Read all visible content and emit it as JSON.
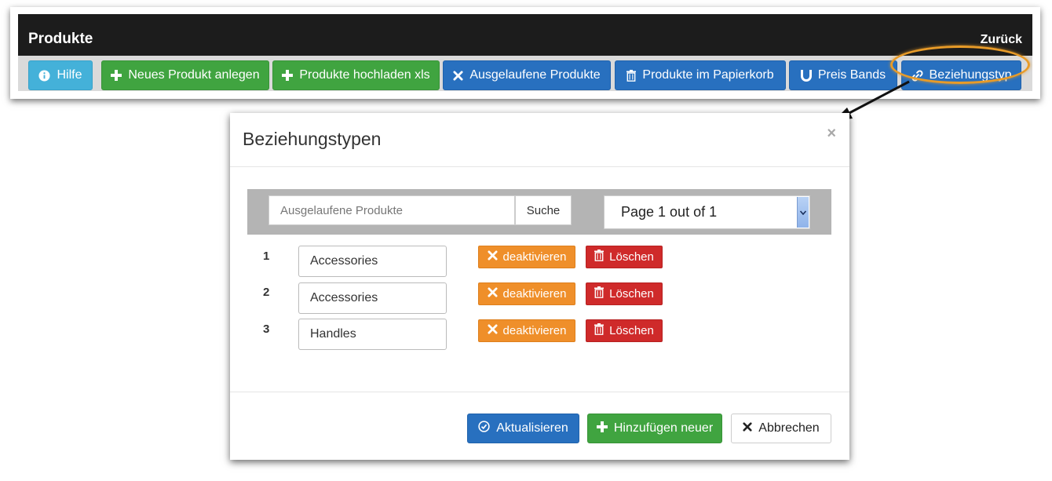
{
  "header": {
    "title": "Produkte",
    "back_label": "Zurück"
  },
  "toolbar": {
    "buttons": [
      {
        "label": "Hilfe",
        "icon": "info-icon",
        "color": "#44b1d9"
      },
      {
        "label": "Neues Produkt anlegen",
        "icon": "plus-icon",
        "color": "#40a440"
      },
      {
        "label": "Produkte hochladen xls",
        "icon": "plus-icon",
        "color": "#40a440"
      },
      {
        "label": "Ausgelaufene Produkte",
        "icon": "times-icon",
        "color": "#2870bf"
      },
      {
        "label": "Produkte im Papierkorb",
        "icon": "trash-icon",
        "color": "#2870bf"
      },
      {
        "label": "Preis Bands",
        "icon": "magnet-icon",
        "color": "#2870bf"
      },
      {
        "label": "Beziehungstyp",
        "icon": "link-icon",
        "color": "#2870bf"
      }
    ],
    "highlighted": "Beziehungstyp",
    "highlight_color": "#e89b28"
  },
  "modal": {
    "title": "Beziehungstypen",
    "close_symbol": "×",
    "search": {
      "placeholder": "Ausgelaufene Produkte",
      "value": "",
      "button_label": "Suche"
    },
    "pagination": {
      "selected": "Page 1 out of 1"
    },
    "rows": [
      {
        "number": "1",
        "value": "Accessories",
        "deactivate_label": "deaktivieren",
        "delete_label": "Löschen"
      },
      {
        "number": "2",
        "value": "Accessories",
        "deactivate_label": "deaktivieren",
        "delete_label": "Löschen"
      },
      {
        "number": "3",
        "value": "Handles",
        "deactivate_label": "deaktivieren",
        "delete_label": "Löschen"
      }
    ],
    "footer": {
      "update_label": "Aktualisieren",
      "add_label": "Hinzufügen neuer",
      "cancel_label": "Abbrechen"
    }
  },
  "colors": {
    "titlebar": "#1c1c1c",
    "orange": "#ef8f2a",
    "red": "#cf2a2a",
    "blue": "#2870bf",
    "green": "#40a440"
  }
}
